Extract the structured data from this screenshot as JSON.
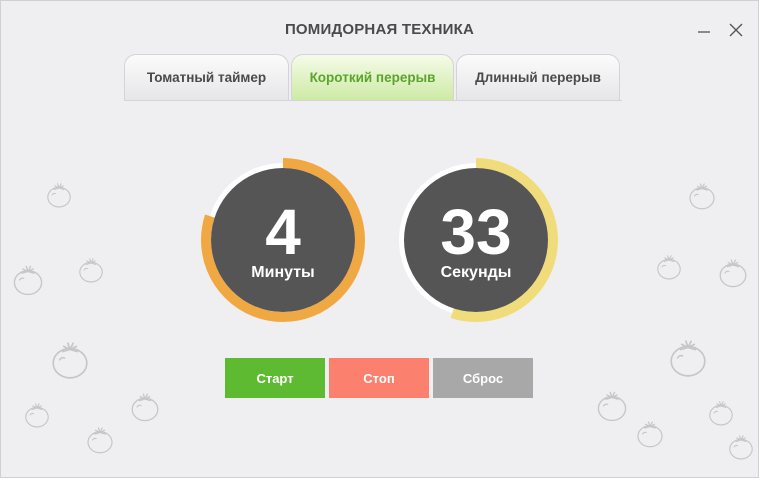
{
  "window": {
    "title": "ПОМИДОРНАЯ ТЕХНИКА",
    "minimize_icon": "minimize-icon",
    "close_icon": "close-icon"
  },
  "tabs": [
    {
      "label": "Томатный таймер",
      "active": false
    },
    {
      "label": "Короткий перерыв",
      "active": true
    },
    {
      "label": "Длинный перерыв",
      "active": false
    }
  ],
  "timer": {
    "minutes": {
      "value": "4",
      "label": "Минуты",
      "progress": 0.8,
      "color": "#f0a843"
    },
    "seconds": {
      "value": "33",
      "label": "Секунды",
      "progress": 0.55,
      "color": "#f0dc7a"
    }
  },
  "buttons": {
    "start": "Старт",
    "stop": "Стоп",
    "reset": "Сброс"
  },
  "colors": {
    "start": "#5dba31",
    "stop": "#fb806d",
    "reset": "#a8a8a8",
    "active_tab": "#5aa52b",
    "dial_fill": "#555555"
  },
  "decor_icon": "tomato-outline-icon"
}
